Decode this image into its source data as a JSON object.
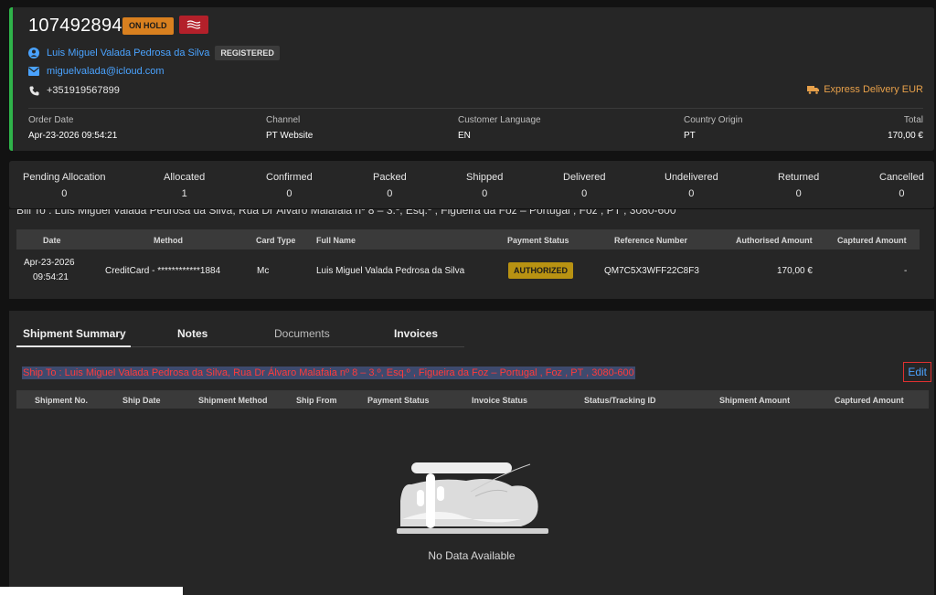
{
  "order": {
    "id": "107492894",
    "status_badge": "ON HOLD",
    "customer_name": "Luis Miguel Valada Pedrosa da Silva",
    "customer_type": "REGISTERED",
    "email": "miguelvalada@icloud.com",
    "phone": "+351919567899",
    "delivery": "Express Delivery EUR"
  },
  "meta": [
    {
      "label": "Order Date",
      "value": "Apr-23-2026 09:54:21"
    },
    {
      "label": "Channel",
      "value": "PT Website"
    },
    {
      "label": "Customer Language",
      "value": "EN"
    },
    {
      "label": "Country Origin",
      "value": "PT"
    },
    {
      "label": "Total",
      "value": "170,00 €"
    }
  ],
  "counts": [
    {
      "label": "Pending Allocation",
      "value": "0"
    },
    {
      "label": "Allocated",
      "value": "1"
    },
    {
      "label": "Confirmed",
      "value": "0"
    },
    {
      "label": "Packed",
      "value": "0"
    },
    {
      "label": "Shipped",
      "value": "0"
    },
    {
      "label": "Delivered",
      "value": "0"
    },
    {
      "label": "Undelivered",
      "value": "0"
    },
    {
      "label": "Returned",
      "value": "0"
    },
    {
      "label": "Cancelled",
      "value": "0"
    }
  ],
  "payment": {
    "bill_to_partial": "Bill To : Luis Miguel Valada Pedrosa da Silva, Rua Dr Álvaro Malafaia nº 8 – 3.º, Esq.º , Figueira da Foz – Portugal , Foz , PT , 3080-600",
    "headers": [
      "Date",
      "Method",
      "Card Type",
      "Full Name",
      "Payment Status",
      "Reference Number",
      "Authorised Amount",
      "Captured Amount"
    ],
    "row": {
      "date_line1": "Apr-23-2026",
      "date_line2": "09:54:21",
      "method": "CreditCard - ************1884",
      "card_type": "Mc",
      "full_name": "Luis Miguel Valada Pedrosa da Silva",
      "status": "AUTHORIZED",
      "reference": "QM7C5X3WFF22C8F3",
      "authorised": "170,00 €",
      "captured": "-"
    }
  },
  "tabs": [
    "Shipment Summary",
    "Notes",
    "Documents",
    "Invoices"
  ],
  "shipment": {
    "ship_to": "Ship To : Luis Miguel Valada Pedrosa da Silva, Rua Dr Álvaro Malafaia nº 8 – 3.º, Esq.º , Figueira da Foz – Portugal , Foz , PT , 3080-600",
    "edit_label": "Edit",
    "headers": [
      "Shipment No.",
      "Ship Date",
      "Shipment Method",
      "Ship From",
      "Payment Status",
      "Invoice Status",
      "Status/Tracking ID",
      "Shipment Amount",
      "Captured Amount"
    ],
    "empty_text": "No Data Available"
  },
  "colors": {
    "accent_green": "#2fb34a",
    "hold": "#d9801f",
    "authorized": "#b89212",
    "link": "#4aa3ff"
  }
}
